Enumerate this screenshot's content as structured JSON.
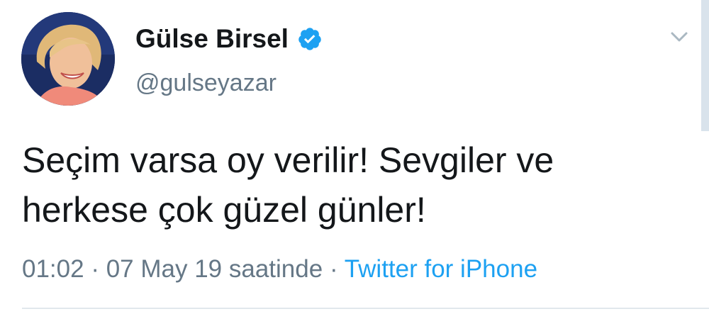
{
  "author": {
    "display_name": "Gülse Birsel",
    "handle": "@gulseyazar",
    "verified": true
  },
  "tweet": {
    "text": "Seçim varsa oy verilir! Sevgiler ve herkese çok güzel günler!",
    "time": "01:02",
    "separator": "·",
    "date": "07 May 19 saatinde",
    "source": "Twitter for iPhone"
  },
  "colors": {
    "accent": "#1da1f2",
    "secondary_text": "#657786",
    "primary_text": "#14171a",
    "divider": "#e1e8ed"
  },
  "icons": {
    "verified": "verified-badge-icon",
    "menu": "chevron-down-icon"
  }
}
